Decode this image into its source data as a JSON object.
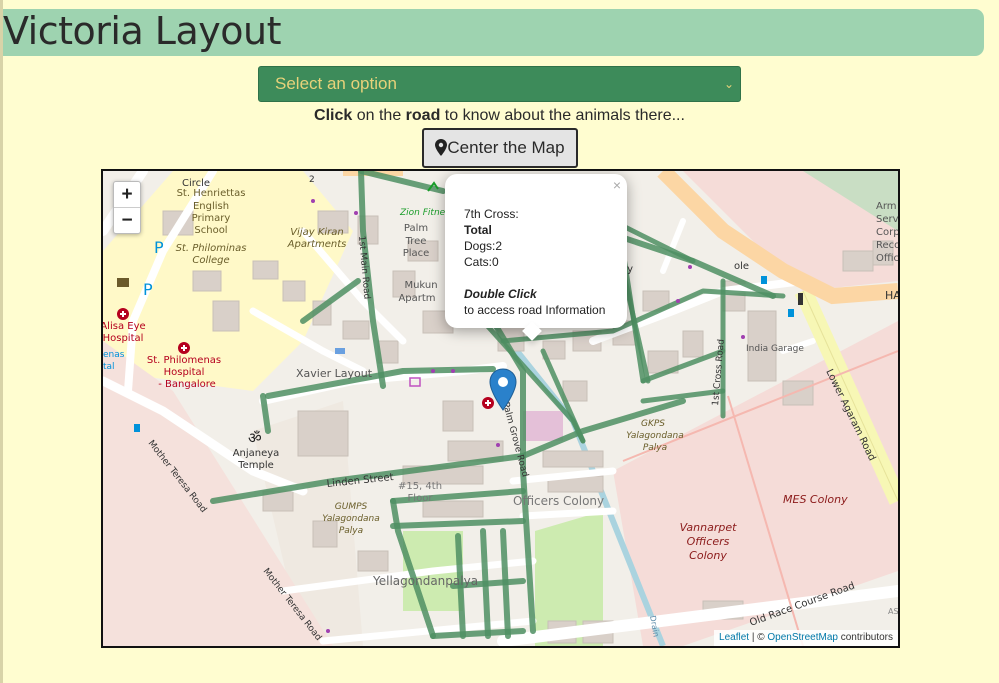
{
  "page": {
    "title": "Victoria Layout"
  },
  "select": {
    "placeholder": "Select an option"
  },
  "instruction": {
    "part1": "Click",
    "part2": " on the ",
    "part3": "road",
    "part4": " to know about the animals there..."
  },
  "center_button": {
    "label": "Center the Map",
    "icon": "map-marker-icon"
  },
  "colors": {
    "page_bg": "#fffdd0",
    "header_bg": "#9ed3b0",
    "select_bg": "#3d8b5a",
    "select_text": "#e7d27a",
    "road_highlight": "#4f8f63",
    "marker": "#2a81cb"
  },
  "map": {
    "zoom_in": "+",
    "zoom_out": "−",
    "popup": {
      "road": "7th Cross:",
      "total_label": "Total",
      "dogs": "Dogs:2",
      "cats": "Cats:0",
      "hint_title": "Double Click",
      "hint_text": "to access road Information",
      "close": "×"
    },
    "attribution": {
      "leaflet": "Leaflet",
      "separator": " | © ",
      "osm": "OpenStreetMap",
      "suffix": " contributors"
    },
    "labels": {
      "circle": "Circle",
      "st_henriettas": [
        "St. Henriettas",
        "English",
        "Primary",
        "School"
      ],
      "st_philominas": [
        "St. Philominas",
        "College"
      ],
      "vijay_kiran": [
        "Vijay Kiran",
        "Apartments"
      ],
      "zion": "Zion Fitne",
      "palm_tree": [
        "Palm",
        "Tree",
        "Place"
      ],
      "mukun": [
        "Mukun",
        "Apartm"
      ],
      "first_main": "1st Main Road",
      "alisa": [
        "Alisa Eye",
        "Hospital"
      ],
      "st_philomenas_hospital": [
        "St. Philomenas",
        "Hospital",
        "- Bangalore"
      ],
      "xavier": "Xavier Layout",
      "anjaneya": [
        "Anjaneya",
        "Temple"
      ],
      "linden": "Linden Street",
      "gumps": [
        "GUMPS",
        "Yalagondana",
        "Palya"
      ],
      "house_15": [
        "#15, 4th",
        "Floor"
      ],
      "officers_colony": "Officers Colony",
      "yellagondanpalya": "Yellagondanpalya",
      "palm_grove": "Palm Grove Road",
      "mother_teresa": "Mother Teresa Road",
      "india_garage": "India Garage",
      "first_cross": "1st Cross Road",
      "gkps": [
        "GKPS",
        "Yalagondana",
        "Palya"
      ],
      "lower_agaram": "Lower Agaram Road",
      "mes_colony": "MES Colony",
      "vannarpet": [
        "Vannarpet",
        "Officers",
        "Colony"
      ],
      "old_race_course": "Old Race Course Road",
      "army": [
        "Arm",
        "Servi",
        "Corp",
        "Reco",
        "Offic"
      ],
      "ha": "HA",
      "drain": "Drain",
      "ay": "ay",
      "ole": "ole",
      "enas": [
        "enas",
        "tal"
      ],
      "num_2": "2",
      "as": "AS"
    }
  }
}
